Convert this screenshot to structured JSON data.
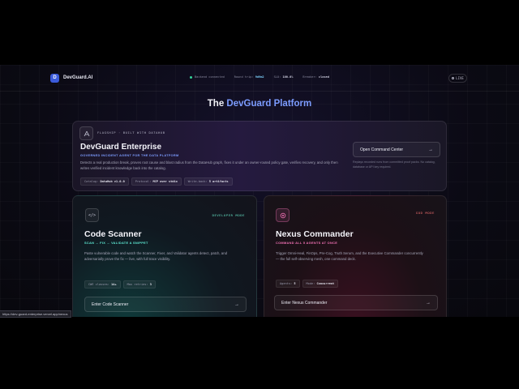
{
  "header": {
    "brand": "DevGuard.AI",
    "logo_letter": "D",
    "backend": "Backend connected",
    "round_trip_label": "Round trip:",
    "round_trip_value": "9d9m2",
    "slo_label": "SLO:",
    "slo_value": "100.0%",
    "breaker_label": "Breaker:",
    "breaker_value": "closed",
    "live_label": "LIVE"
  },
  "page": {
    "title_prefix": "The ",
    "title_accent": "DevGuard Platform"
  },
  "flagship": {
    "tag": "FLAGSHIP · BUILT WITH DATAHUB",
    "title": "DevGuard Enterprise",
    "subtitle": "GOVERNED INCIDENT AGENT FOR THE DATA PLATFORM",
    "description": "Detects a real production break, proves root cause and blast radius from the DataHub graph, fixes it under an owner-routed policy gate, verifies recovery, and only then writes verified incident knowledge back into the catalog.",
    "chips": [
      {
        "label": "Catalog:",
        "value": "DataHub v1.0.0"
      },
      {
        "label": "Protocol:",
        "value": "MCP over stdio"
      },
      {
        "label": "Write-back:",
        "value": "5 artifacts"
      }
    ],
    "cta": "Open Command Center",
    "note": "Replays recorded runs from committed proof packs. No catalog, database or API key required."
  },
  "scanner": {
    "tag": "DEVELOPER MODE",
    "icon": "</>",
    "title": "Code Scanner",
    "subtitle": "SCAN → FIX → VALIDATE A SNIPPET",
    "description": "Paste vulnerable code and watch the Scanner, Fixer, and Validator agents detect, patch, and adversarially prove the fix — live, with full trace visibility.",
    "chips": [
      {
        "label": "CWE classes:",
        "value": "14+"
      },
      {
        "label": "Max retries:",
        "value": "3"
      }
    ],
    "cta": "Enter Code Scanner"
  },
  "nexus": {
    "tag": "GOD MODE",
    "title": "Nexus Commander",
    "subtitle": "COMMAND ALL 5 AGENTS AT ONCE",
    "description": "Trigger Omni-Heal, FinOps, Pre-Cog, Truth Serum, and the Executive Commander concurrently — the full self-observing mesh, one command deck.",
    "chips": [
      {
        "label": "Agents:",
        "value": "5"
      },
      {
        "label": "Mode:",
        "value": "Concurrent"
      }
    ],
    "cta": "Enter Nexus Commander"
  },
  "statusbar": {
    "url": "https://dev-guard-enterprise.vercel.app/nexus"
  },
  "colors": {
    "accent": "#7c9cff",
    "teal": "#5eead4",
    "pink": "#f472b6",
    "scanner_tag": "#67e8c9",
    "nexus_tag": "#f87171"
  }
}
